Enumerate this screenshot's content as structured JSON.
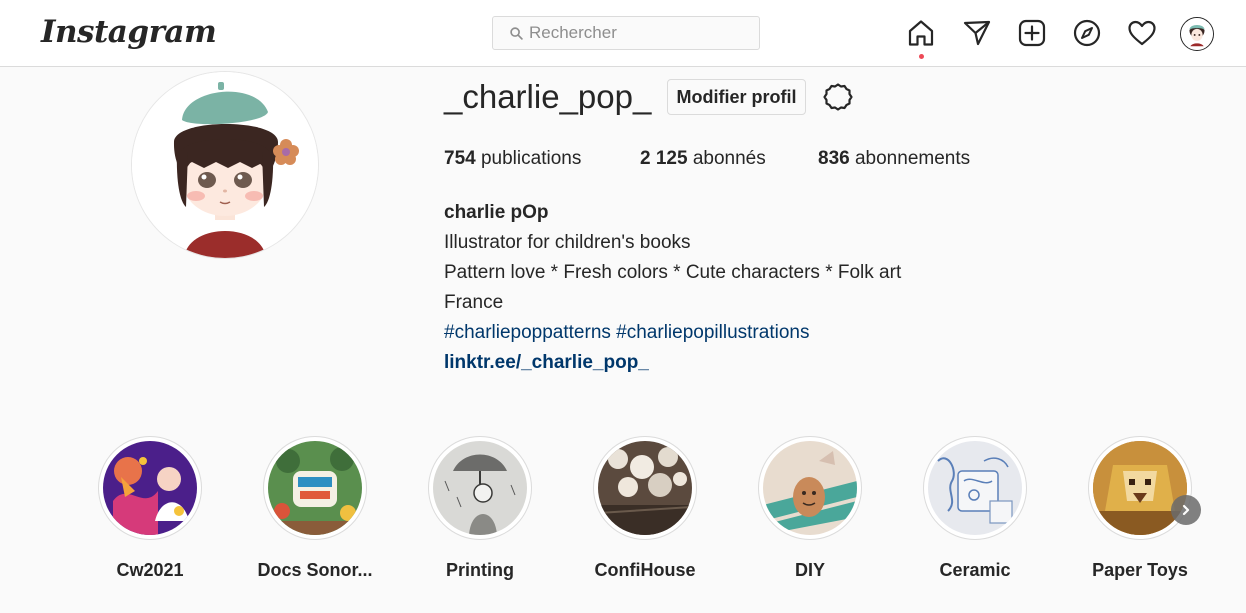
{
  "header": {
    "logo": "Instagram",
    "search_placeholder": "Rechercher"
  },
  "nav": {
    "icons": [
      "home-icon",
      "direct-message-icon",
      "new-post-icon",
      "explore-icon",
      "activity-heart-icon",
      "profile-avatar"
    ]
  },
  "profile": {
    "username": "_charlie_pop_",
    "edit_button": "Modifier profil",
    "stats": {
      "posts_count": "754",
      "posts_label": "publications",
      "followers_count": "2 125",
      "followers_label": "abonnés",
      "following_count": "836",
      "following_label": "abonnements"
    },
    "bio": {
      "full_name": "charlie pOp",
      "line1": "Illustrator for children's books",
      "line2": "Pattern love * Fresh colors * Cute characters * Folk art",
      "line3": "France",
      "hashtag1": "#charliepoppatterns",
      "hashtag2": "#charliepopillustrations",
      "link": "linktr.ee/_charlie_pop_"
    }
  },
  "highlights": [
    {
      "label": "Cw2021"
    },
    {
      "label": "Docs Sonores"
    },
    {
      "label": "Printing"
    },
    {
      "label": "ConfiHouse"
    },
    {
      "label": "DIY"
    },
    {
      "label": "Ceramic"
    },
    {
      "label": "Paper Toys"
    }
  ],
  "colors": {
    "background": "#fafafa",
    "link": "#00376b",
    "notification": "#ed4956",
    "border": "#dbdbdb"
  }
}
